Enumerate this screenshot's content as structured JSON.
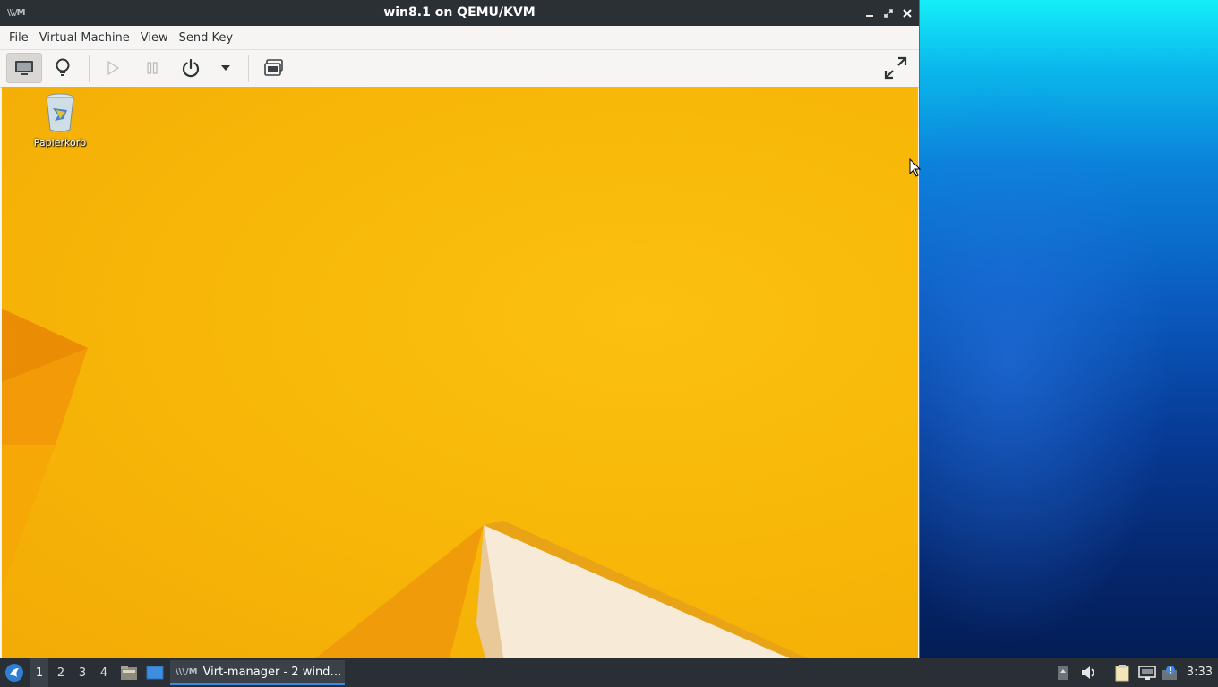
{
  "window": {
    "title": "win8.1 on QEMU/KVM",
    "app_icon": "virt-manager-icon"
  },
  "menubar": {
    "items": [
      "File",
      "Virtual Machine",
      "View",
      "Send Key"
    ]
  },
  "toolbar": {
    "buttons": [
      "console-icon",
      "details-lightbulb-icon",
      "run-icon",
      "pause-icon",
      "power-icon",
      "power-dropdown-icon",
      "snapshot-icon",
      "fullscreen-icon"
    ]
  },
  "guest": {
    "desktop_icons": [
      {
        "label": "Papierkorb",
        "icon": "recycle-bin-icon"
      }
    ],
    "accent": "#f8b808"
  },
  "taskbar": {
    "workspaces": [
      "1",
      "2",
      "3",
      "4"
    ],
    "current_workspace": "1",
    "task_label": "Virt-manager - 2 wind…",
    "clock": "3:33"
  }
}
